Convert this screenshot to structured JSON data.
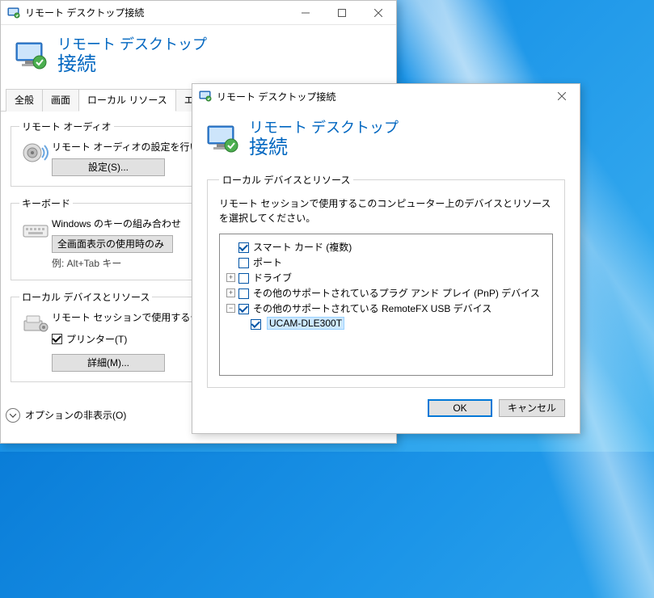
{
  "w1": {
    "title": "リモート デスクトップ接続",
    "banner1": "リモート デスクトップ",
    "banner2": "接続",
    "tabs": {
      "general": "全般",
      "display": "画面",
      "local": "ローカル リソース",
      "exp": "エクスペ"
    },
    "audio": {
      "legend": "リモート オーディオ",
      "desc": "リモート オーディオの設定を行い",
      "btn": "設定(S)..."
    },
    "keyboard": {
      "legend": "キーボード",
      "desc": "Windows のキーの組み合わせ",
      "btn": "全画面表示の使用時のみ",
      "example": "例: Alt+Tab キー"
    },
    "local": {
      "legend": "ローカル デバイスとリソース",
      "desc": "リモート セッションで使用するデ",
      "printer": "プリンター(T)",
      "btn": "詳細(M)..."
    },
    "options": "オプションの非表示(O)"
  },
  "w2": {
    "title": "リモート デスクトップ接続",
    "banner1": "リモート デスクトップ",
    "banner2": "接続",
    "legend": "ローカル デバイスとリソース",
    "instr": "リモート セッションで使用するこのコンピューター上のデバイスとリソースを選択してください。",
    "tree": {
      "smartcard": "スマート カード (複数)",
      "port": "ポート",
      "drive": "ドライブ",
      "pnp": "その他のサポートされているプラグ アンド プレイ (PnP) デバイス",
      "usb": "その他のサポートされている RemoteFX USB デバイス",
      "ucam": "UCAM-DLE300T"
    },
    "ok": "OK",
    "cancel": "キャンセル"
  }
}
